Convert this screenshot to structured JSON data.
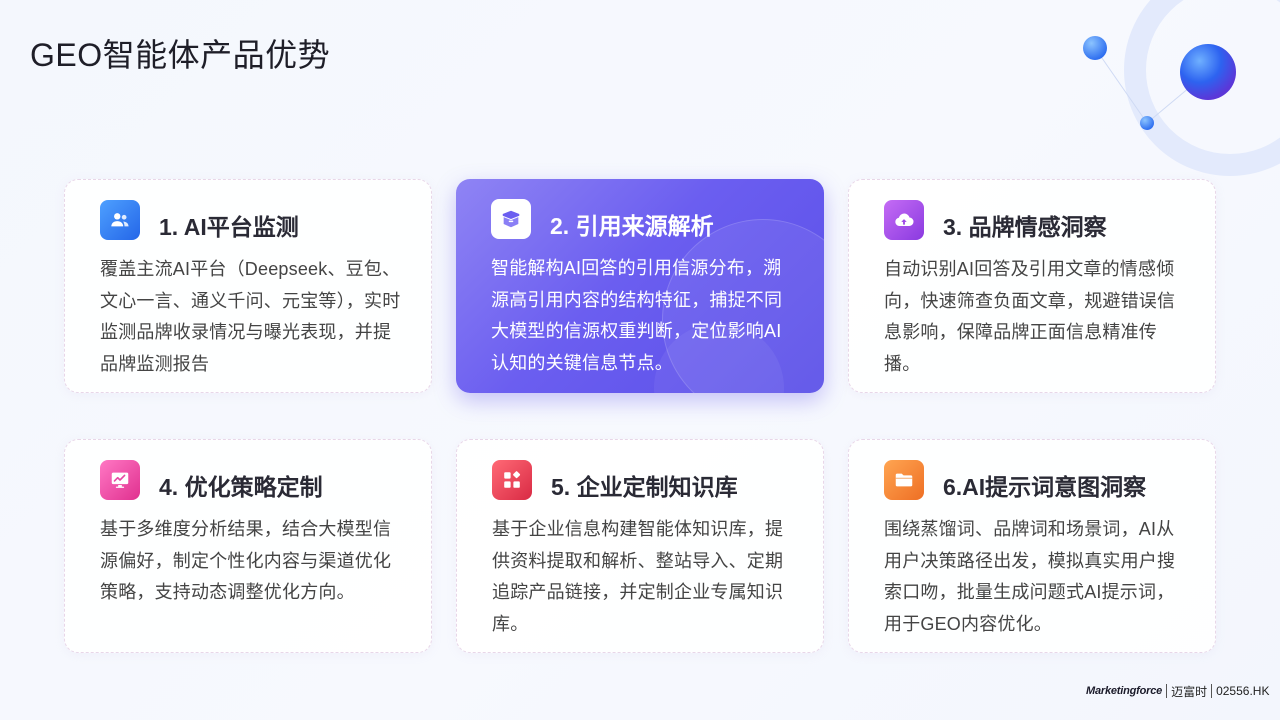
{
  "page": {
    "title": "GEO智能体产品优势"
  },
  "cards": [
    {
      "title": "1. AI平台监测",
      "body": "覆盖主流AI平台（Deepseek、豆包、文心一言、通义千问、元宝等），实时监测品牌收录情况与曝光表现，并提品牌监测报告",
      "icon": "users-icon",
      "icon_color": "#2f7cf0"
    },
    {
      "title": "2. 引用来源解析",
      "body": "智能解构AI回答的引用信源分布，溯源高引用内容的结构特征，捕捉不同大模型的信源权重判断，定位影响AI认知的关键信息节点。",
      "icon": "box-icon",
      "icon_color": "#6b5ef0"
    },
    {
      "title": "3. 品牌情感洞察",
      "body": "自动识别AI回答及引用文章的情感倾向，快速筛查负面文章，规避错误信息影响，保障品牌正面信息精准传播。",
      "icon": "cloud-upload-icon",
      "icon_color": "#a64de8"
    },
    {
      "title": "4. 优化策略定制",
      "body": "基于多维度分析结果，结合大模型信源偏好，制定个性化内容与渠道优化策略，支持动态调整优化方向。",
      "icon": "monitor-chart-icon",
      "icon_color": "#e74aa4"
    },
    {
      "title": "5. 企业定制知识库",
      "body": "基于企业信息构建智能体知识库，提供资料提取和解析、整站导入、定期追踪产品链接，并定制企业专属知识库。",
      "icon": "apps-grid-icon",
      "icon_color": "#ea3f55"
    },
    {
      "title": "6.AI提示词意图洞察",
      "body": "围绕蒸馏词、品牌词和场景词，AI从用户决策路径出发，模拟真实用户搜索口吻，批量生成问题式AI提示词，用于GEO内容优化。",
      "icon": "folder-icon",
      "icon_color": "#f08a3a"
    }
  ],
  "footer": {
    "brand": "Marketingforce",
    "name_cn": "迈富时",
    "ticker": "02556.HK"
  }
}
